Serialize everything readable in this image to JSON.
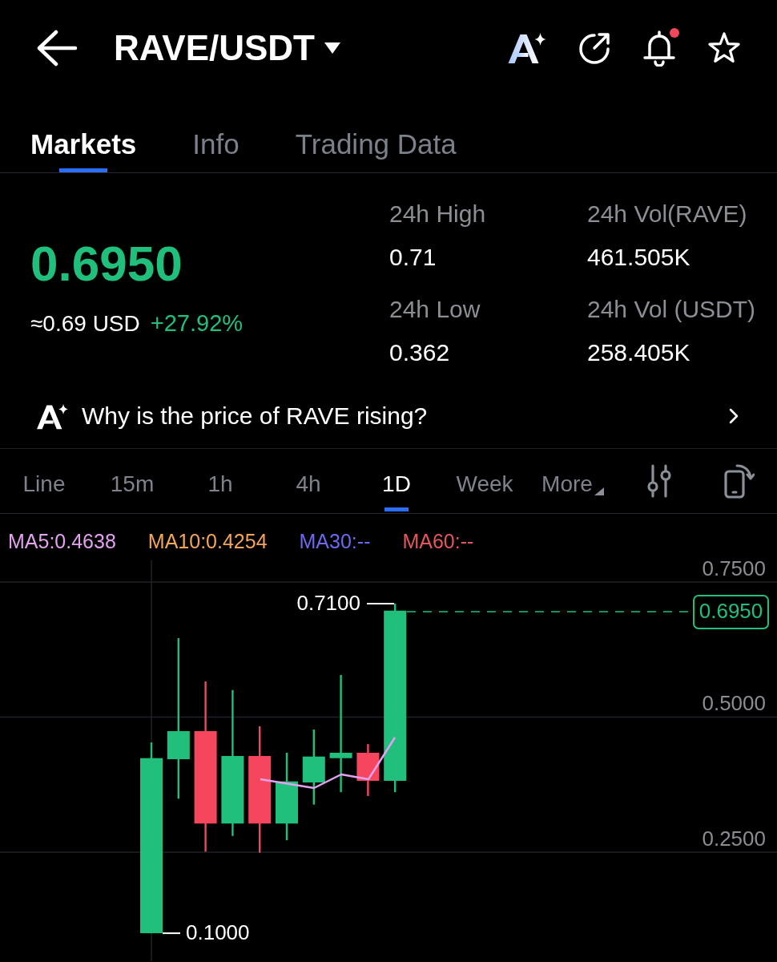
{
  "header": {
    "title": "RAVE/USDT",
    "unread_alert": true
  },
  "tabs": [
    {
      "label": "Markets",
      "selected": true
    },
    {
      "label": "Info",
      "selected": false
    },
    {
      "label": "Trading Data",
      "selected": false
    }
  ],
  "ticker": {
    "price": "0.6950",
    "usd_value": "≈0.69 USD",
    "change": "+27.92%",
    "stats": [
      {
        "label": "24h High",
        "value": "0.71"
      },
      {
        "label": "24h Vol(RAVE)",
        "value": "461.505K"
      },
      {
        "label": "24h Low",
        "value": "0.362"
      },
      {
        "label": "24h Vol (USDT)",
        "value": "258.405K"
      }
    ]
  },
  "insight": {
    "text": "Why is the price of RAVE rising?"
  },
  "intervals": [
    {
      "label": "Line",
      "kind": "period",
      "selected": false
    },
    {
      "label": "15m",
      "kind": "period",
      "selected": false
    },
    {
      "label": "1h",
      "kind": "period",
      "selected": false
    },
    {
      "label": "4h",
      "kind": "period",
      "selected": false
    },
    {
      "label": "1D",
      "kind": "period",
      "selected": true
    },
    {
      "label": "Week",
      "kind": "period",
      "selected": false
    },
    {
      "label": "More",
      "kind": "menu",
      "selected": false
    }
  ],
  "indicators": [
    {
      "label": "MA5:0.4638",
      "color": "#e3a1f0"
    },
    {
      "label": "MA10:0.4254",
      "color": "#f3a65a"
    },
    {
      "label": "MA30:--",
      "color": "#6c68f0"
    },
    {
      "label": "MA60:--",
      "color": "#e3575c"
    }
  ],
  "chart": {
    "y_labels": [
      "0.7500",
      "0.5000",
      "0.2500"
    ],
    "last_price": "0.6950",
    "high_label": "0.7100",
    "low_label": "0.1000",
    "candles": [
      {
        "kind": "rise"
      },
      {
        "kind": "rise"
      },
      {
        "kind": "fall"
      },
      {
        "kind": "rise"
      },
      {
        "kind": "fall"
      },
      {
        "kind": "rise"
      },
      {
        "kind": "rise"
      },
      {
        "kind": "rise"
      },
      {
        "kind": "fall"
      },
      {
        "kind": "rise"
      }
    ]
  }
}
